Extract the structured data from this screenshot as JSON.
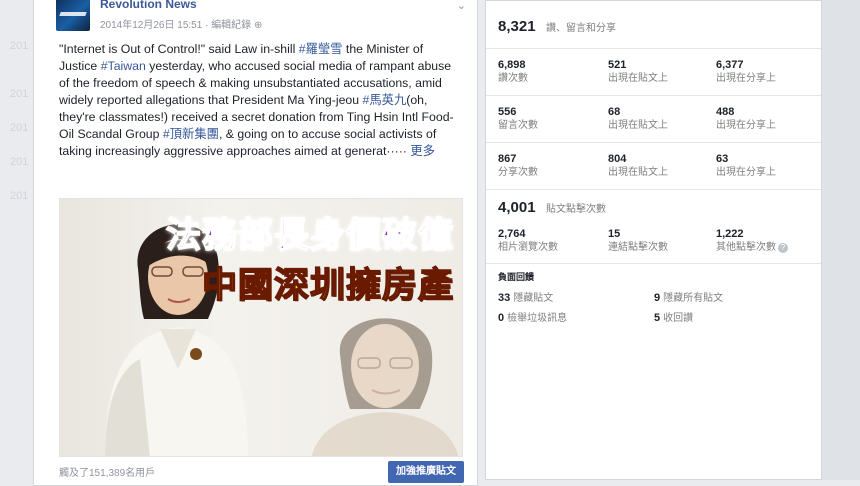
{
  "post": {
    "page_name": "Revolution News",
    "date": "2014年12月26日 15:51",
    "edited": "編輯紀錄",
    "text": {
      "q1": "\"Internet is Out of Control!\" said Law in-shill ",
      "tag1": "#羅瑩雪",
      "q2": " the Minister of Justice ",
      "tag2": "#Taiwan",
      "q3": " yesterday, who accused social media of rampant abuse of the freedom of speech & making unsubstantiated accusations, amid widely reported allegations that President Ma Ying-jeou ",
      "tag3": "#馬英九",
      "q4": "(oh, they're classmates!) received a secret donation from Ting Hsin Intl Food-Oil Scandal Group ",
      "tag4": "#頂新集團",
      "q5": ", & going on to accuse social activists of taking increasingly aggressive approaches aimed at generat·····",
      "more": "更多"
    },
    "image": {
      "headline_line1": "法務部長身價破億",
      "headline_line2": "中國深圳擁房產"
    },
    "footer_reach": "觸及了151,389名用戶",
    "boost_label": "加強推廣貼文"
  },
  "insights": {
    "total_actions": {
      "value": "8,321",
      "label": "讚、留言和分享"
    },
    "likes_row": [
      {
        "value": "6,898",
        "label": "讚次數"
      },
      {
        "value": "521",
        "label": "出現在貼文上"
      },
      {
        "value": "6,377",
        "label": "出現在分享上"
      }
    ],
    "comments_row": [
      {
        "value": "556",
        "label": "留言次數"
      },
      {
        "value": "68",
        "label": "出現在貼文上"
      },
      {
        "value": "488",
        "label": "出現在分享上"
      }
    ],
    "shares_row": [
      {
        "value": "867",
        "label": "分享次數"
      },
      {
        "value": "804",
        "label": "出現在貼文上"
      },
      {
        "value": "63",
        "label": "出現在分享上"
      }
    ],
    "post_clicks": {
      "value": "4,001",
      "label": "貼文點擊次數"
    },
    "clicks_row": [
      {
        "value": "2,764",
        "label": "相片瀏覽次數"
      },
      {
        "value": "15",
        "label": "連結點擊次數"
      },
      {
        "value": "1,222",
        "label": "其他點擊次數"
      }
    ],
    "negative_feedback": {
      "title": "負面回饋",
      "items": [
        {
          "value": "33",
          "label": "隱藏貼文"
        },
        {
          "value": "9",
          "label": "隱藏所有貼文"
        },
        {
          "value": "0",
          "label": "檢舉垃圾訊息"
        },
        {
          "value": "5",
          "label": "收回讚"
        }
      ]
    }
  },
  "background": {
    "ghost_labels": [
      "201",
      "201",
      "201",
      "201",
      "201"
    ]
  },
  "colors": {
    "accent": "#3b5998",
    "link": "#365899",
    "button": "#4267b2",
    "headline_purple": "#8a1fd1",
    "headline_yellow": "#f4e21a"
  }
}
